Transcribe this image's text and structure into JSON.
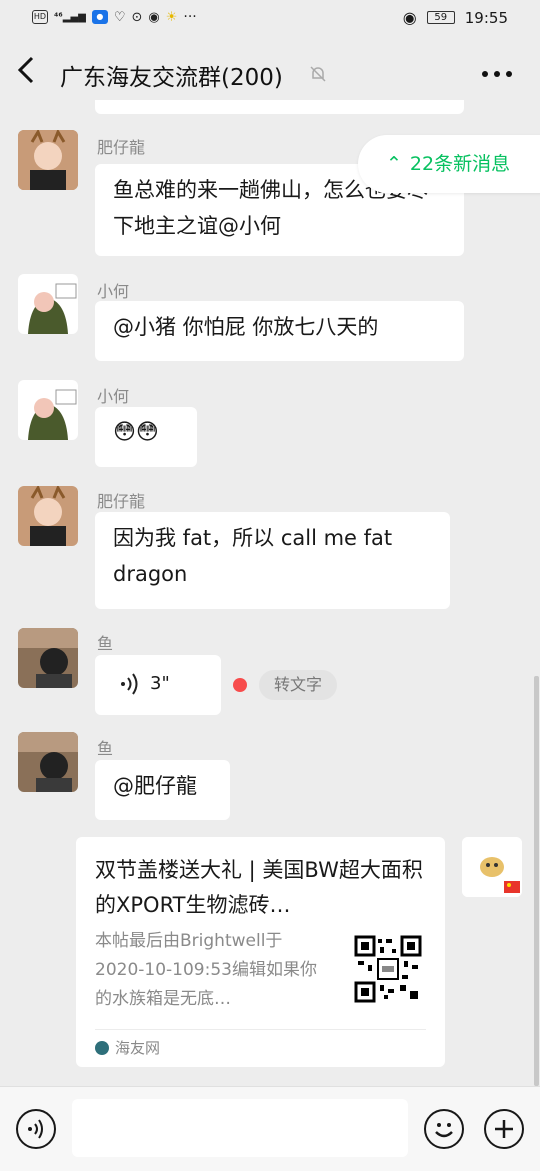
{
  "statusbar": {
    "left_icons": [
      "hd-icon",
      "signal-4g-icon",
      "app-notification-icon",
      "heart-icon",
      "location-icon",
      "qq-icon",
      "more-dots-icon"
    ],
    "eye_icon": "eye-icon",
    "battery": "59",
    "time": "19:55"
  },
  "header": {
    "title": "广东海友交流群(200)",
    "back_icon": "chevron-left-icon",
    "mute_icon": "bell-off-icon",
    "more_icon": "more-horizontal-icon"
  },
  "new_messages": "22条新消息",
  "messages": [
    {
      "sender": "肥仔龍",
      "text": "鱼总难的来一趟佛山，怎么也要尽下地主之谊@小何"
    },
    {
      "sender": "小何",
      "text": "@小猪  你怕屁  你放七八天的"
    },
    {
      "sender": "小何",
      "text": "😳😳"
    },
    {
      "sender": "肥仔龍",
      "text": "因为我 fat，所以 call me fat dragon"
    },
    {
      "sender": "鱼",
      "voice": "3\"",
      "convert": "转文字"
    },
    {
      "sender": "鱼",
      "text": "@肥仔龍"
    }
  ],
  "card": {
    "title": "双节盖楼送大礼 | 美国BW超大面积的XPORT生物滤砖…",
    "desc": "本帖最后由Brightwell于2020-10-109:53编辑如果你的水族箱是无底…",
    "source": "海友网"
  },
  "inputbar": {
    "voice_icon": "voice-input-icon",
    "emoji_icon": "emoji-icon",
    "plus_icon": "plus-circle-icon"
  },
  "colors": {
    "accent_green": "#07c160",
    "bubble": "#ffffff",
    "background": "#ededed",
    "unread_dot": "#f74c4c"
  }
}
